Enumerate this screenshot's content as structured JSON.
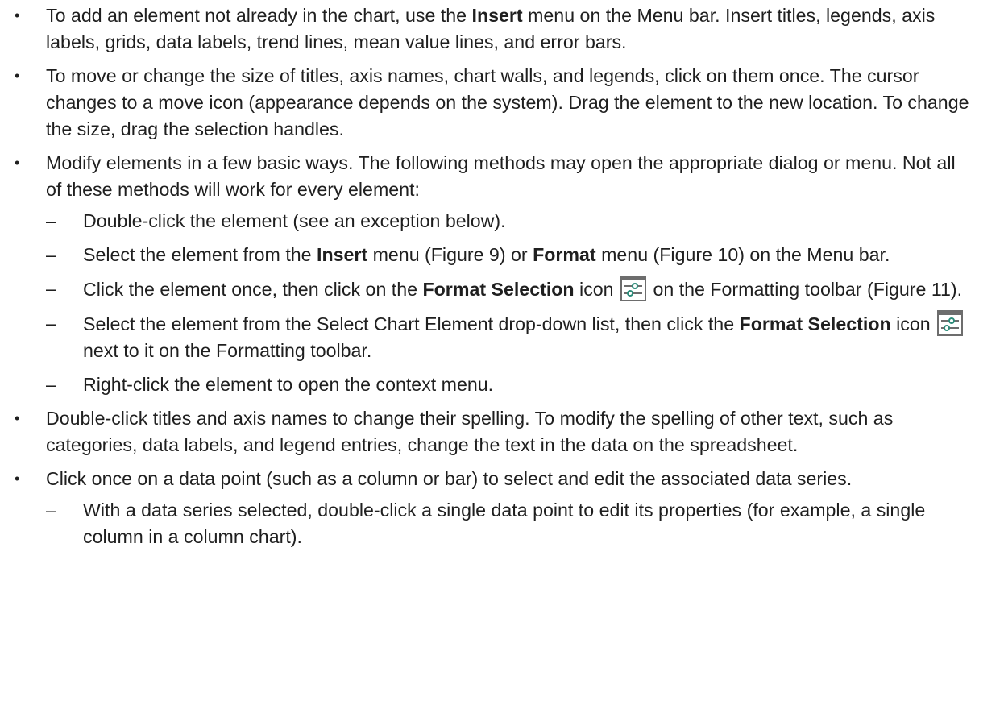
{
  "bullets": {
    "b1": {
      "pre": "To add an element not already in the chart, use the ",
      "bold": "Insert",
      "post": " menu on the Menu bar. Insert titles, legends, axis labels, grids, data labels, trend lines, mean value lines, and error bars."
    },
    "b2": "To move or change the size of titles, axis names, chart walls, and legends, click on them once. The cursor changes to a move icon (appearance depends on the system). Drag the element to the new location. To change the size, drag the selection handles.",
    "b3": {
      "text": "Modify elements in a few basic ways. The following methods may open the appropriate dialog or menu. Not all of these methods will work for every element:",
      "s1": "Double-click the element (see an exception below).",
      "s2": {
        "pre": "Select the element from the ",
        "bold1": "Insert",
        "mid1": " menu (Figure 9) or ",
        "bold2": "Format",
        "post": " menu (Figure 10) on the Menu bar."
      },
      "s3": {
        "pre": "Click the element once, then click on the ",
        "bold": "Format Selection",
        "mid": " icon ",
        "post": " on the Formatting toolbar (Figure 11)."
      },
      "s4": {
        "pre": "Select the element from the Select Chart Element drop-down list, then click the ",
        "bold": "Format Selection",
        "mid": " icon ",
        "post": " next to it on the Formatting toolbar."
      },
      "s5": "Right-click the element to open the context menu."
    },
    "b4": "Double-click titles and axis names to change their spelling. To modify the spelling of other text, such as categories, data labels, and legend entries, change the text in the data on the spreadsheet.",
    "b5": {
      "text": "Click once on a data point (such as a column or bar) to select and edit the associated data series.",
      "s1": "With a data series selected, double-click a single data point to edit its properties (for example, a single column in a column chart)."
    }
  },
  "bullet_symbol": "•",
  "dash_symbol": "–",
  "icons": {
    "format_selection": "format-selection-icon"
  },
  "colors": {
    "text": "#1f1f1f",
    "icon_frame": "#6d6d6d",
    "icon_accent": "#2d8c7a"
  }
}
